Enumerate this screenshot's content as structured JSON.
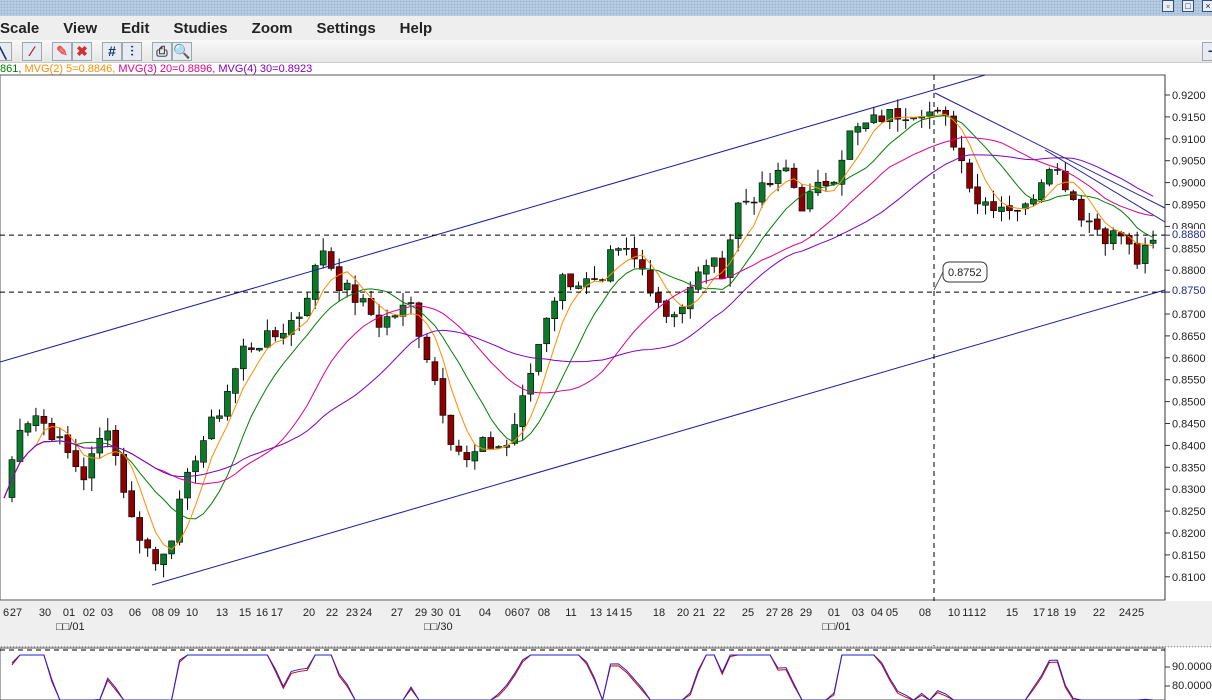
{
  "menu": [
    "Scale",
    "View",
    "Edit",
    "Studies",
    "Zoom",
    "Settings",
    "Help"
  ],
  "legend": {
    "mvg1": "861",
    "mvg2": "MVG(2) 5=0.8846",
    "mvg3": "MVG(3) 20=0.8896",
    "mvg4": "MVG(4) 30=0.8923",
    "colors": {
      "mvg1": "#008000",
      "mvg2": "#ff8c00",
      "mvg3": "#e0008c",
      "mvg4": "#8000c0"
    }
  },
  "toolbar_icons": [
    "draw-line-icon",
    "delete-line-icon",
    "eraser-icon",
    "delete-icon",
    "grid-icon",
    "grid-values-icon",
    "print-icon",
    "print-preview-icon"
  ],
  "price_axis": {
    "min": 0.81,
    "max": 0.92,
    "step": 0.005,
    "highlighted": [
      "0.8880",
      "0.8750"
    ]
  },
  "indicator_axis": [
    "90.0000",
    "80.0000"
  ],
  "price_label": "0.8752",
  "date_labels": [
    "6",
    "27",
    "30",
    "01",
    "02",
    "03",
    "06",
    "08",
    "09",
    "10",
    "13",
    "15",
    "16",
    "17",
    "20",
    "22",
    "23",
    "24",
    "27",
    "29",
    "30",
    "01",
    "04",
    "06",
    "07",
    "08",
    "11",
    "13",
    "14",
    "15",
    "18",
    "20",
    "21",
    "22",
    "25",
    "27",
    "28",
    "29",
    "01",
    "03",
    "04",
    "05",
    "08",
    "10",
    "11",
    "12",
    "15",
    "17",
    "18",
    "19",
    "22",
    "24",
    "25"
  ],
  "month_labels": [
    "□□/01",
    "□□/30",
    "□□/01"
  ],
  "chart_data": {
    "type": "candlestick",
    "waypoints": [
      [
        0,
        0.828
      ],
      [
        2,
        0.845
      ],
      [
        4,
        0.847
      ],
      [
        6,
        0.843
      ],
      [
        10,
        0.833
      ],
      [
        13,
        0.845
      ],
      [
        16,
        0.823
      ],
      [
        19,
        0.813
      ],
      [
        21,
        0.82
      ],
      [
        24,
        0.838
      ],
      [
        27,
        0.848
      ],
      [
        30,
        0.862
      ],
      [
        34,
        0.865
      ],
      [
        37,
        0.87
      ],
      [
        40,
        0.885
      ],
      [
        42,
        0.877
      ],
      [
        45,
        0.872
      ],
      [
        47,
        0.868
      ],
      [
        51,
        0.872
      ],
      [
        54,
        0.855
      ],
      [
        56,
        0.842
      ],
      [
        58,
        0.836
      ],
      [
        60,
        0.84
      ],
      [
        63,
        0.84
      ],
      [
        65,
        0.85
      ],
      [
        68,
        0.87
      ],
      [
        70,
        0.878
      ],
      [
        73,
        0.877
      ],
      [
        75,
        0.876
      ],
      [
        76,
        0.883
      ],
      [
        78,
        0.884
      ],
      [
        80,
        0.88
      ],
      [
        83,
        0.87
      ],
      [
        85,
        0.872
      ],
      [
        88,
        0.882
      ],
      [
        90,
        0.88
      ],
      [
        92,
        0.895
      ],
      [
        95,
        0.898
      ],
      [
        98,
        0.903
      ],
      [
        100,
        0.895
      ],
      [
        104,
        0.902
      ],
      [
        106,
        0.911
      ],
      [
        110,
        0.915
      ],
      [
        115,
        0.917
      ],
      [
        118,
        0.914
      ],
      [
        120,
        0.905
      ],
      [
        122,
        0.896
      ],
      [
        125,
        0.895
      ],
      [
        128,
        0.894
      ],
      [
        131,
        0.905
      ],
      [
        133,
        0.9
      ],
      [
        135,
        0.893
      ],
      [
        138,
        0.888
      ],
      [
        140,
        0.888
      ],
      [
        142,
        0.882
      ],
      [
        145,
        0.888
      ]
    ]
  }
}
